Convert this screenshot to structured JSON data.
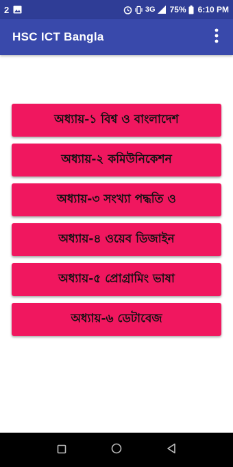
{
  "status_bar": {
    "notification_count": "2",
    "battery_percent": "75%",
    "network_type": "3G",
    "time": "6:10 PM"
  },
  "app_bar": {
    "title": "HSC ICT Bangla"
  },
  "chapters": [
    {
      "label": "অধ্যায়-১  বিশ্ব ও বাংলাদেশ"
    },
    {
      "label": "অধ্যায়-২ কমিউনিকেশন"
    },
    {
      "label": "অধ্যায়-৩ সংখ্যা পদ্ধতি ও"
    },
    {
      "label": "অধ্যায়-৪ ওয়েব ডিজাইন"
    },
    {
      "label": "অধ্যায়-৫ প্রোগ্রামিং ভাষা"
    },
    {
      "label": "অধ্যায়-৬ ডেটাবেজ"
    }
  ],
  "colors": {
    "status_bar": "#2f3d96",
    "app_bar": "#3949ab",
    "button": "#f0175f",
    "nav_bar": "#000000"
  },
  "icons": {
    "overflow": "more-vert-icon",
    "nav": [
      "recents-icon",
      "home-icon",
      "back-icon"
    ]
  }
}
